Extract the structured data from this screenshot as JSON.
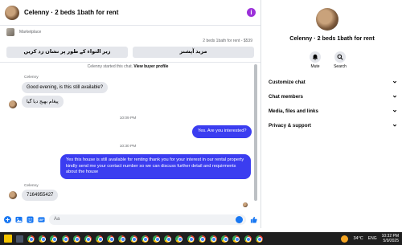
{
  "chat": {
    "title": "Celenny · 2 beds 1bath for rent",
    "marketplace_label": "Marketplace",
    "listing_line": "2 beds 1bath for rent - $539",
    "buttons": [
      "زیر التواء کے طور پر نشان زد کریں",
      "مزید آپشنز"
    ],
    "system_note": "Celenny started this chat.",
    "system_link": "View buyer profile",
    "messages": [
      {
        "sender": "Celenny",
        "text": "Good evening, is this still available?"
      },
      {
        "text": "پیغام بھیج دیا گیا"
      },
      {
        "time": "10:09 PM"
      },
      {
        "text": "Yes. Are you interested?"
      },
      {
        "time": "10:30 PM"
      },
      {
        "text": "Yes this house is still available for renting thank you for your interest in our rental property kindly send me your contact number so we can discuss further detail and requirments about the house"
      },
      {
        "sender": "Celenny",
        "text": "7164955427"
      }
    ],
    "composer_placeholder": "Aa"
  },
  "info_pane": {
    "title": "Celenny · 2 beds 1bath for rent",
    "quick_actions": [
      {
        "label": "Mute",
        "icon": "bell-icon"
      },
      {
        "label": "Search",
        "icon": "search-icon"
      }
    ],
    "sections": [
      "Customize chat",
      "Chat members",
      "Media, files and links",
      "Privacy & support"
    ]
  },
  "taskbar": {
    "temperature": "34°C",
    "language": "ENG",
    "time": "10:32 PM",
    "date": "5/9/2025"
  },
  "colors": {
    "outgoing_bubble": "#3b3df0",
    "incoming_bubble": "#e4e6eb",
    "accent_blue": "#1877f2",
    "info_purple": "#9b30d9"
  }
}
